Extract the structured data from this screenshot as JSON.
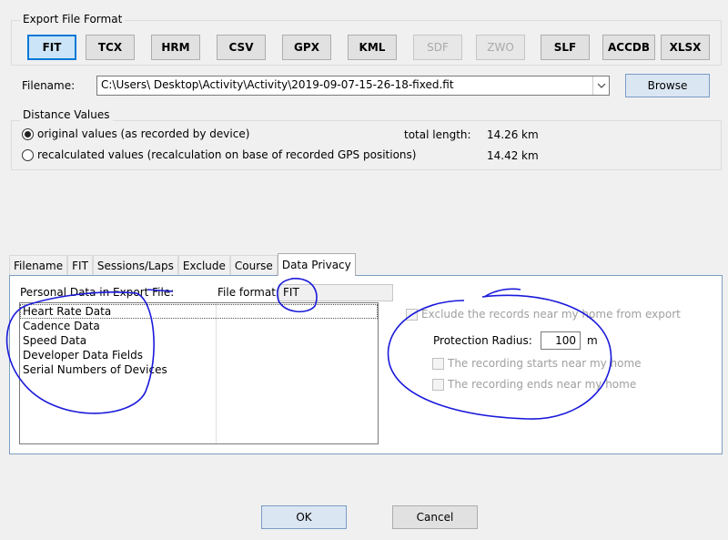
{
  "export_format": {
    "title": "Export File Format",
    "buttons": [
      {
        "label": "FIT",
        "state": "selected"
      },
      {
        "label": "TCX",
        "state": "normal"
      },
      {
        "label": "HRM",
        "state": "normal"
      },
      {
        "label": "CSV",
        "state": "normal"
      },
      {
        "label": "GPX",
        "state": "normal"
      },
      {
        "label": "KML",
        "state": "normal"
      },
      {
        "label": "SDF",
        "state": "disabled"
      },
      {
        "label": "ZWO",
        "state": "disabled"
      },
      {
        "label": "SLF",
        "state": "normal"
      },
      {
        "label": "ACCDB",
        "state": "normal"
      },
      {
        "label": "XLSX",
        "state": "normal"
      }
    ]
  },
  "filename": {
    "label": "Filename:",
    "value": "C:\\Users\\          Desktop\\Activity\\Activity\\2019-09-07-15-26-18-fixed.fit",
    "browse_label": "Browse"
  },
  "distance": {
    "title": "Distance Values",
    "option_original": "original values (as recorded by device)",
    "option_recalc": "recalculated values (recalculation on base of recorded GPS positions)",
    "total_length_label": "total length:",
    "original_value": "14.26",
    "recalc_value": "14.42",
    "unit": "km"
  },
  "tabs": [
    "Filename",
    "FIT",
    "Sessions/Laps",
    "Exclude",
    "Course",
    "Data Privacy"
  ],
  "privacy": {
    "personal_data_label": "Personal Data in Export File:",
    "file_format_label": "File format:",
    "file_format_value": "FIT",
    "personal_items": [
      "Heart Rate Data",
      "Cadence Data",
      "Speed Data",
      "Developer Data Fields",
      "Serial Numbers of Devices"
    ],
    "exclude_label": "Exclude the records near my home from export",
    "radius_label": "Protection Radius:",
    "radius_value": "100",
    "radius_unit": "m",
    "starts_label": "The recording starts near my home",
    "ends_label": "The recording ends near my home"
  },
  "dialog": {
    "ok_label": "OK",
    "cancel_label": "Cancel"
  },
  "colors": {
    "annotation": "#1a1adb",
    "selected_border": "#0078d7"
  }
}
